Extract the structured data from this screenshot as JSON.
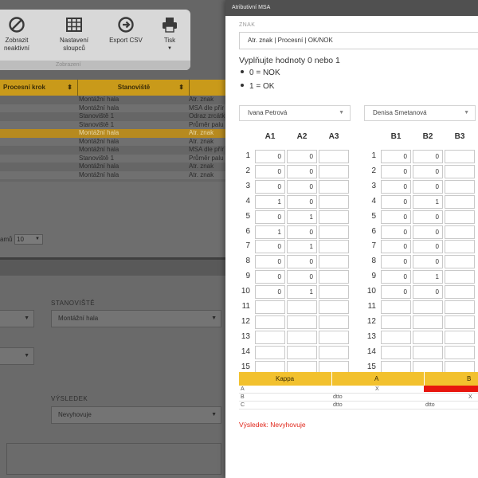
{
  "toolbar": {
    "buttons": [
      {
        "label": "Zobrazit\nneaktivní"
      },
      {
        "label": "Nastavení\nsloupců"
      },
      {
        "label": "Export CSV"
      },
      {
        "label": "Tisk"
      }
    ],
    "group_caption": "Zobrazení"
  },
  "table": {
    "headers": [
      "Procesní krok",
      "Stanoviště"
    ],
    "rows": [
      {
        "stanoviste": "Montážní hala",
        "col3": "Atr. znak"
      },
      {
        "stanoviste": "Montážní hala",
        "col3": "MSA dle přír"
      },
      {
        "stanoviste": "Stanoviště 1",
        "col3": "Odraz zrcátk"
      },
      {
        "stanoviste": "Stanoviště 1",
        "col3": "Průměr palu"
      },
      {
        "stanoviste": "Montážní hala",
        "col3": "Atr. znak"
      },
      {
        "stanoviste": "Montážní hala",
        "col3": "Atr. znak"
      },
      {
        "stanoviste": "Montážní hala",
        "col3": "MSA dle přír"
      },
      {
        "stanoviste": "Stanoviště 1",
        "col3": "Průměr palu"
      },
      {
        "stanoviste": "Montážní hala",
        "col3": "Atr. znak"
      },
      {
        "stanoviste": "Montážní hala",
        "col3": "Atr. znak"
      }
    ],
    "highlighted_row": 4,
    "pager_label": "amů",
    "pager_value": "10"
  },
  "form": {
    "stanoviste_label": "STANOVIŠTĚ",
    "stanoviste_value": "Montážní hala",
    "vysledek_label": "VÝSLEDEK",
    "vysledek_value": "Nevyhovuje"
  },
  "modal": {
    "title": "Atributivní MSA",
    "znak_label": "ZNAK",
    "znak_value": "Atr. znak | Procesní | OK/NOK",
    "instruction": "Vyplňujte hodnoty 0 nebo 1",
    "bullets": [
      "0 = NOK",
      "1 = OK"
    ],
    "operator_a": "Ivana Petrová",
    "operator_b": "Denisa Smetanová",
    "cols_a": [
      "A1",
      "A2",
      "A3"
    ],
    "cols_b": [
      "B1",
      "B2",
      "B3"
    ],
    "row_numbers": [
      "1",
      "2",
      "3",
      "4",
      "5",
      "6",
      "7",
      "8",
      "9",
      "10",
      "11",
      "12",
      "13",
      "14",
      "15"
    ],
    "values_a": [
      [
        "0",
        "0",
        ""
      ],
      [
        "0",
        "0",
        ""
      ],
      [
        "0",
        "0",
        ""
      ],
      [
        "1",
        "0",
        ""
      ],
      [
        "0",
        "1",
        ""
      ],
      [
        "1",
        "0",
        ""
      ],
      [
        "0",
        "1",
        ""
      ],
      [
        "0",
        "0",
        ""
      ],
      [
        "0",
        "0",
        ""
      ],
      [
        "0",
        "1",
        ""
      ],
      [
        "",
        "",
        ""
      ],
      [
        "",
        "",
        ""
      ],
      [
        "",
        "",
        ""
      ],
      [
        "",
        "",
        ""
      ],
      [
        "",
        "",
        ""
      ]
    ],
    "values_b": [
      [
        "0",
        "0",
        ""
      ],
      [
        "0",
        "0",
        ""
      ],
      [
        "0",
        "0",
        ""
      ],
      [
        "0",
        "1",
        ""
      ],
      [
        "0",
        "0",
        ""
      ],
      [
        "0",
        "0",
        ""
      ],
      [
        "0",
        "0",
        ""
      ],
      [
        "0",
        "0",
        ""
      ],
      [
        "0",
        "1",
        ""
      ],
      [
        "0",
        "0",
        ""
      ],
      [
        "",
        "",
        ""
      ],
      [
        "",
        "",
        ""
      ],
      [
        "",
        "",
        ""
      ],
      [
        "",
        "",
        ""
      ],
      [
        "",
        "",
        ""
      ]
    ],
    "kappa": {
      "header": [
        "Kappa",
        "A",
        "B"
      ],
      "rows": [
        {
          "label": "A",
          "a": "X",
          "b": ""
        },
        {
          "label": "B",
          "a": "dtto",
          "b": "X"
        },
        {
          "label": "C",
          "a": "dtto",
          "b": "dtto"
        }
      ]
    },
    "result": "Výsledek: Nevyhovuje"
  },
  "colors": {
    "accent": "#f2c12e",
    "fail": "#e8160e",
    "result_text": "#e0261a"
  }
}
